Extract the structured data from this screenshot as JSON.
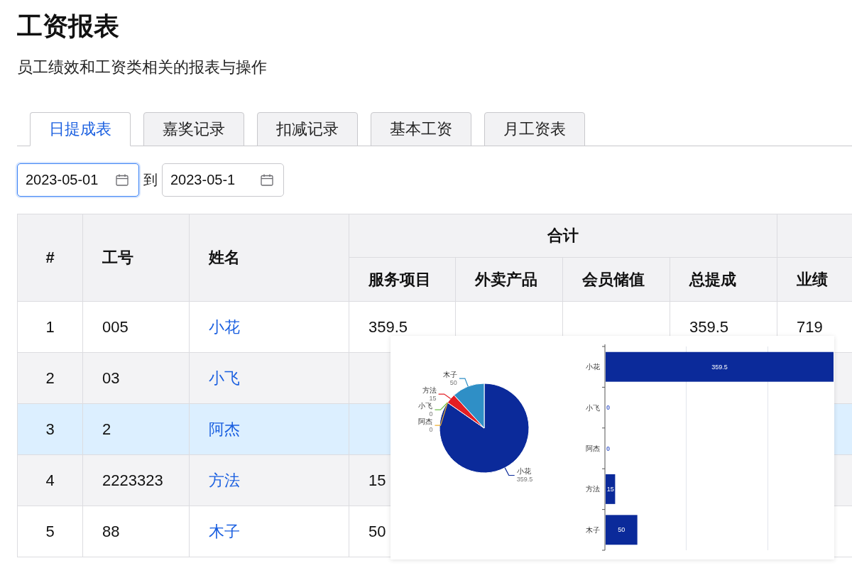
{
  "page": {
    "title": "工资报表",
    "subtitle": "员工绩效和工资类相关的报表与操作"
  },
  "tabs": [
    {
      "label": "日提成表",
      "selected": true
    },
    {
      "label": "嘉奖记录",
      "selected": false
    },
    {
      "label": "扣减记录",
      "selected": false
    },
    {
      "label": "基本工资",
      "selected": false
    },
    {
      "label": "月工资表",
      "selected": false
    }
  ],
  "date_range": {
    "fields": [
      {
        "value": "2023-05-01",
        "focused": true
      },
      {
        "value": "2023-05-1",
        "focused": false
      }
    ],
    "separator": "到"
  },
  "table": {
    "columns": [
      {
        "label": "#"
      },
      {
        "label": "工号"
      },
      {
        "label": "姓名"
      },
      {
        "label": "合计",
        "children": [
          {
            "label": "服务项目"
          },
          {
            "label": "外卖产品"
          },
          {
            "label": "会员储值"
          },
          {
            "label": "总提成"
          }
        ]
      },
      {
        "children": [
          {
            "label": "业绩"
          }
        ]
      }
    ],
    "rows": [
      {
        "number": "1",
        "staff_id": "005",
        "name": "小花",
        "service_items": "359.5",
        "total_commission": "359.5",
        "performance": "719",
        "selected": false
      },
      {
        "number": "2",
        "staff_id": "03",
        "name": "小飞",
        "selected": false
      },
      {
        "number": "3",
        "staff_id": "2",
        "name": "阿杰",
        "selected": true
      },
      {
        "number": "4",
        "staff_id": "2223323",
        "name": "方法",
        "service_items": "15",
        "selected": false
      },
      {
        "number": "5",
        "staff_id": "88",
        "name": "木子",
        "service_items": "50",
        "selected": false
      }
    ]
  },
  "chart_popup": {
    "charts": [
      {
        "chart_data": {
          "type": "pie",
          "categories": [
            "小花",
            "小飞",
            "阿杰",
            "方法",
            "木子"
          ],
          "values": [
            359.5,
            0,
            0,
            15,
            50
          ],
          "data_labels": true,
          "value_labels": [
            "359.5",
            "0",
            "0",
            "15",
            "50"
          ]
        }
      },
      {
        "chart_data": {
          "type": "bar",
          "orientation": "horizontal",
          "categories": [
            "小花",
            "小飞",
            "阿杰",
            "方法",
            "木子"
          ],
          "values": [
            359.5,
            0,
            0,
            15,
            50
          ],
          "data_labels": true
        }
      }
    ]
  }
}
